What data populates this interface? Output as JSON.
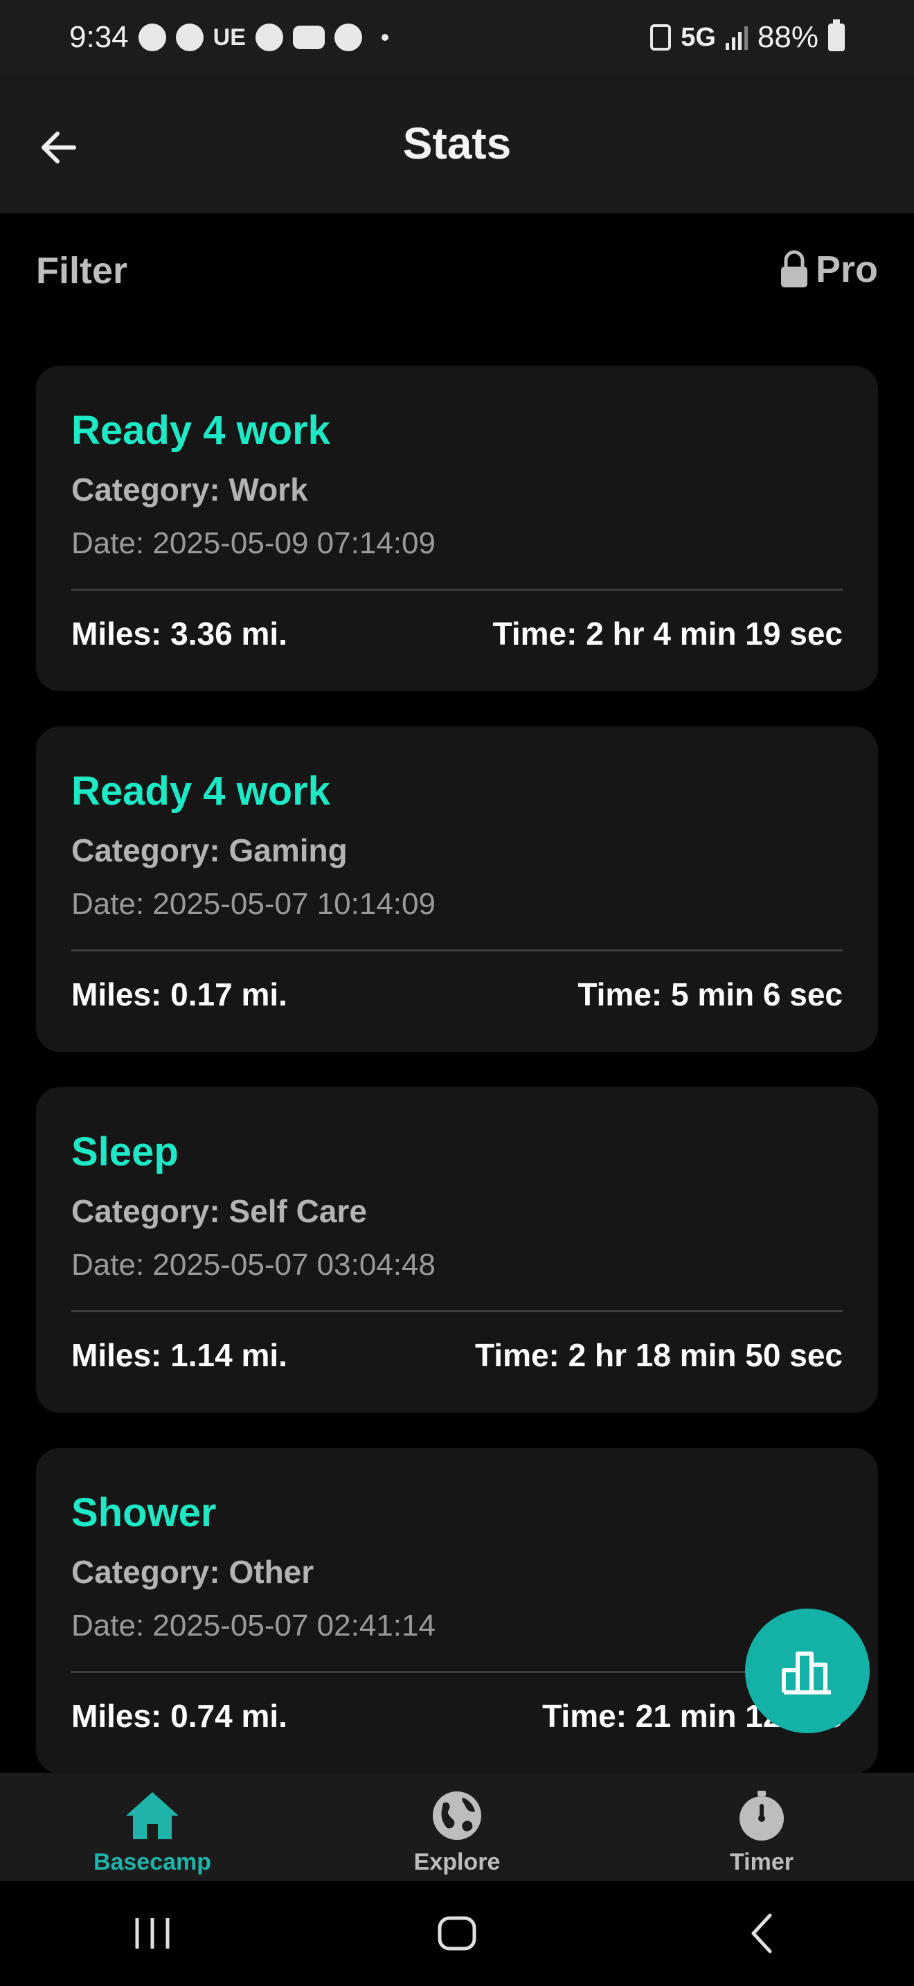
{
  "status_bar": {
    "time": "9:34",
    "ue": "UE",
    "network": "5G",
    "battery": "88%"
  },
  "header": {
    "title": "Stats"
  },
  "filter": {
    "label": "Filter",
    "pro_label": "Pro"
  },
  "entries": [
    {
      "title": "Ready 4 work",
      "category": "Category: Work",
      "date": "Date: 2025-05-09 07:14:09",
      "miles": "Miles: 3.36 mi.",
      "time": "Time: 2 hr 4 min 19 sec"
    },
    {
      "title": "Ready 4 work",
      "category": "Category: Gaming",
      "date": "Date: 2025-05-07 10:14:09",
      "miles": "Miles: 0.17 mi.",
      "time": "Time: 5 min 6 sec"
    },
    {
      "title": "Sleep",
      "category": "Category: Self Care",
      "date": "Date: 2025-05-07 03:04:48",
      "miles": "Miles: 1.14 mi.",
      "time": "Time: 2 hr 18 min 50 sec"
    },
    {
      "title": "Shower",
      "category": "Category: Other",
      "date": "Date: 2025-05-07 02:41:14",
      "miles": "Miles: 0.74 mi.",
      "time": "Time: 21 min 12 sec"
    }
  ],
  "fab": {
    "icon": "bar-chart-icon"
  },
  "bottom_nav": {
    "items": [
      {
        "label": "Basecamp",
        "icon": "home-icon",
        "active": true
      },
      {
        "label": "Explore",
        "icon": "globe-icon",
        "active": false
      },
      {
        "label": "Timer",
        "icon": "timer-icon",
        "active": false
      }
    ]
  },
  "colors": {
    "accent": "#1de9c6",
    "fab": "#14b1a6",
    "active_nav": "#1fb3a9",
    "card_bg": "#161616"
  }
}
